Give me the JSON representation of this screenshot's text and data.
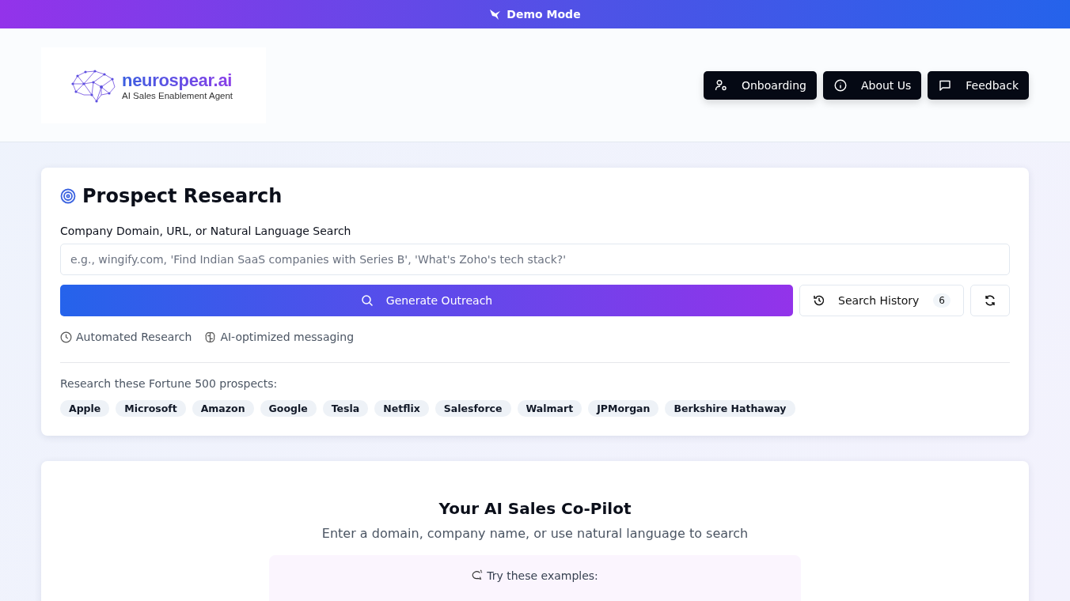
{
  "banner": {
    "label": "Demo Mode"
  },
  "logo": {
    "name": "neurospear.ai",
    "tagline": "AI Sales Enablement Agent"
  },
  "nav_buttons": [
    {
      "label": "Onboarding"
    },
    {
      "label": "About Us"
    },
    {
      "label": "Feedback"
    }
  ],
  "research": {
    "title": "Prospect Research",
    "field_label": "Company Domain, URL, or Natural Language Search",
    "search": {
      "placeholder": "e.g., wingify.com, 'Find Indian SaaS companies with Series B', 'What's Zoho's tech stack?'"
    },
    "generate_button": "Generate Outreach",
    "history_button": {
      "label": "Search History",
      "count": "6"
    },
    "features": [
      "Automated Research",
      "AI-optimized messaging"
    ],
    "prospects_label": "Research these Fortune 500 prospects:",
    "prospects": [
      "Apple",
      "Microsoft",
      "Amazon",
      "Google",
      "Tesla",
      "Netflix",
      "Salesforce",
      "Walmart",
      "JPMorgan",
      "Berkshire Hathaway"
    ]
  },
  "copilot": {
    "title": "Your AI Sales Co-Pilot",
    "subtitle": "Enter a domain, company name, or use natural language to search",
    "examples_label": "Try these examples:"
  }
}
